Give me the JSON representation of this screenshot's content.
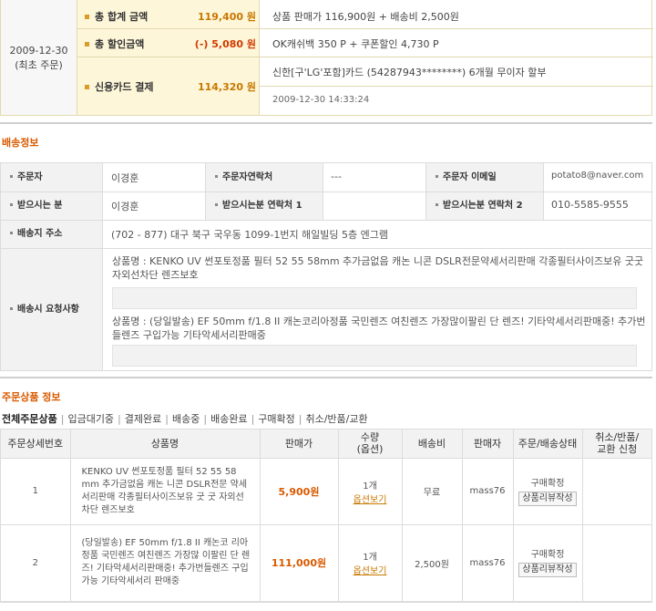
{
  "payment": {
    "order_date": "2009-12-30",
    "order_type": "(최초 주문)",
    "total_label": "총 합계 금액",
    "total_value": "119,400 원",
    "total_detail": "상품 판매가 116,900원 + 배송비 2,500원",
    "discount_label": "총 할인금액",
    "discount_value": "(-) 5,080 원",
    "discount_detail": "OK캐쉬백 350 P + 쿠폰할인 4,730 P",
    "card_label": "신용카드 결제",
    "card_value": "114,320 원",
    "card_detail": "신한[구'LG'포함]카드 (54287943********) 6개월 무이자 할부",
    "card_time": "2009-12-30 14:33:24"
  },
  "shipping": {
    "title": "배송정보",
    "orderer_label": "주문자",
    "orderer": "이경훈",
    "orderer_phone_label": "주문자연락처",
    "orderer_phone": "---",
    "orderer_email_label": "주문자 이메일",
    "orderer_email": "potato8@naver.com",
    "receiver_label": "받으시는 분",
    "receiver": "이경훈",
    "receiver_phone1_label": "받으시는분 연락처 1",
    "receiver_phone1": "",
    "receiver_phone2_label": "받으시는분 연락처 2",
    "receiver_phone2": "010-5585-9555",
    "address_label": "배송지 주소",
    "address": "(702 - 877) 대구 북구 국우동 1099-1번지 해일빌딩 5층 엔그램",
    "request_label": "배송시 요청사항",
    "request1": "상품명 : KENKO UV 썬포토정품 필터 52 55 58mm 추가금없음 캐논 니콘 DSLR전문약세서리판매 각종필터사이즈보유 굿굿 자외선차단 렌즈보호",
    "request2": "상품명 : (당일발송) EF 50mm f/1.8 II 캐논코리아정품 국민렌즈 여친렌즈 가장많이팔린 단 렌즈! 기타악세서리판매중! 추가번들렌즈 구입가능 기타악세서리판매중"
  },
  "order_items": {
    "title": "주문상품 정보",
    "tabs": [
      "전체주문상품",
      "입금대기중",
      "결제완료",
      "배송중",
      "배송완료",
      "구매확정",
      "취소/반품/교환"
    ],
    "headers": [
      "주문상세번호",
      "상품명",
      "판매가",
      "수량\n(옵션)",
      "배송비",
      "판매자",
      "주문/배송상태",
      "취소/반품/\n교환 신청"
    ],
    "rows": [
      {
        "no": "1",
        "name": "KENKO UV 썬포토정품 필터 52 55 58 mm 추가금없음 캐논 니콘 DSLR전문 약세서리판매 각종필터사이즈보유 굿 굿 자외선차단 렌즈보호",
        "price": "5,900원",
        "qty": "1개",
        "option_link": "옵션보기",
        "shipping_fee": "무료",
        "seller": "mass76",
        "status": "구매확정",
        "review_button": "상품리뷰작성",
        "cancel": ""
      },
      {
        "no": "2",
        "name": "(당일발송) EF 50mm f/1.8 II 캐논코 리아정품 국민렌즈 여친렌즈 가장많 이팔린 단 렌즈! 기타악세서리판매중! 추가번들렌즈 구입가능 기타악세서리 판매중",
        "price": "111,000원",
        "qty": "1개",
        "option_link": "옵션보기",
        "shipping_fee": "2,500원",
        "seller": "mass76",
        "status": "구매확정",
        "review_button": "상품리뷰작성",
        "cancel": ""
      }
    ]
  },
  "colors": {
    "accent_orange": "#d85a00",
    "gold": "#c87800",
    "label_bg": "#fdf6d9"
  }
}
